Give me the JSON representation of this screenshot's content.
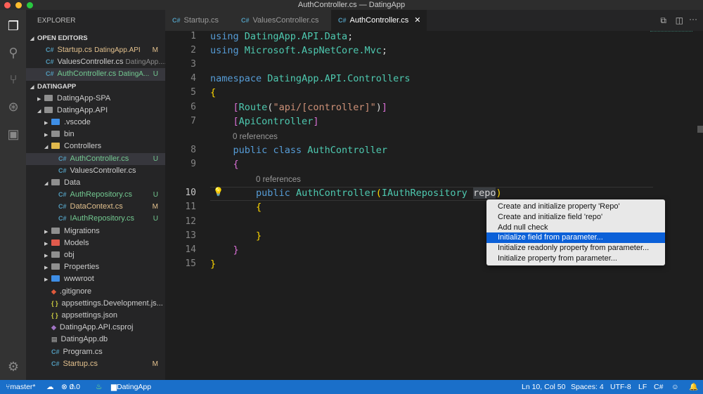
{
  "window": {
    "title": "AuthController.cs — DatingApp"
  },
  "sidebar": {
    "title": "EXPLORER",
    "open_editors_label": "OPEN EDITORS",
    "open_editors": [
      {
        "name": "Startup.cs",
        "folder": "DatingApp.API",
        "badge": "M"
      },
      {
        "name": "ValuesController.cs",
        "folder": "DatingApp....",
        "badge": ""
      },
      {
        "name": "AuthController.cs",
        "folder": "DatingA...",
        "badge": "U"
      }
    ],
    "project_label": "DATINGAPP",
    "tree": [
      {
        "name": "DatingApp-SPA",
        "type": "folder",
        "depth": 0,
        "open": false,
        "badge": ""
      },
      {
        "name": "DatingApp.API",
        "type": "folder",
        "depth": 0,
        "open": true,
        "badge": ""
      },
      {
        "name": ".vscode",
        "type": "folder",
        "depth": 1,
        "open": false,
        "badge": ""
      },
      {
        "name": "bin",
        "type": "folder",
        "depth": 1,
        "open": false,
        "badge": ""
      },
      {
        "name": "Controllers",
        "type": "folder",
        "depth": 1,
        "open": true,
        "badge": ""
      },
      {
        "name": "AuthController.cs",
        "type": "cs",
        "depth": 2,
        "badge": "U"
      },
      {
        "name": "ValuesController.cs",
        "type": "cs",
        "depth": 2,
        "badge": ""
      },
      {
        "name": "Data",
        "type": "folder",
        "depth": 1,
        "open": true,
        "badge": ""
      },
      {
        "name": "AuthRepository.cs",
        "type": "cs",
        "depth": 2,
        "badge": "U"
      },
      {
        "name": "DataContext.cs",
        "type": "cs",
        "depth": 2,
        "badge": "M"
      },
      {
        "name": "IAuthRepository.cs",
        "type": "cs",
        "depth": 2,
        "badge": "U"
      },
      {
        "name": "Migrations",
        "type": "folder",
        "depth": 1,
        "open": false,
        "badge": ""
      },
      {
        "name": "Models",
        "type": "folder",
        "depth": 1,
        "open": false,
        "badge": ""
      },
      {
        "name": "obj",
        "type": "folder",
        "depth": 1,
        "open": false,
        "badge": ""
      },
      {
        "name": "Properties",
        "type": "folder",
        "depth": 1,
        "open": false,
        "badge": ""
      },
      {
        "name": "wwwroot",
        "type": "folder",
        "depth": 1,
        "open": false,
        "badge": ""
      },
      {
        "name": ".gitignore",
        "type": "file",
        "depth": 1,
        "badge": ""
      },
      {
        "name": "appsettings.Development.js...",
        "type": "json",
        "depth": 1,
        "badge": ""
      },
      {
        "name": "appsettings.json",
        "type": "json",
        "depth": 1,
        "badge": ""
      },
      {
        "name": "DatingApp.API.csproj",
        "type": "proj",
        "depth": 1,
        "badge": ""
      },
      {
        "name": "DatingApp.db",
        "type": "file",
        "depth": 1,
        "badge": ""
      },
      {
        "name": "Program.cs",
        "type": "cs",
        "depth": 1,
        "badge": ""
      },
      {
        "name": "Startup.cs",
        "type": "cs",
        "depth": 1,
        "badge": "M"
      }
    ]
  },
  "tabs": [
    {
      "label": "Startup.cs",
      "active": false
    },
    {
      "label": "ValuesController.cs",
      "active": false
    },
    {
      "label": "AuthController.cs",
      "active": true
    }
  ],
  "editor": {
    "lines": [
      "1",
      "2",
      "3",
      "4",
      "5",
      "6",
      "7",
      "8",
      "9",
      "10",
      "11",
      "12",
      "13",
      "14",
      "15"
    ],
    "code": {
      "l1": [
        "using",
        "DatingApp.API.Data",
        ";"
      ],
      "l2": [
        "using",
        "Microsoft.AspNetCore.Mvc",
        ";"
      ],
      "l4": [
        "namespace",
        "DatingApp.API.Controllers"
      ],
      "l6": [
        "[",
        "Route",
        "(",
        "\"api/[controller]\"",
        ")",
        "]"
      ],
      "l7": [
        "[",
        "ApiController",
        "]"
      ],
      "l8": [
        "public",
        "class",
        "AuthController"
      ],
      "l10": [
        "public",
        "AuthController",
        "(",
        "IAuthRepository",
        "repo",
        ")"
      ],
      "open": "{",
      "close": "}"
    },
    "codelens": "0 references"
  },
  "quick_fix_menu": {
    "items": [
      "Create and initialize property 'Repo'",
      "Create and initialize field 'repo'",
      "Add null check",
      "Initialize field from parameter...",
      "Initialize readonly property from parameter...",
      "Initialize property from parameter..."
    ],
    "highlighted": 3
  },
  "status": {
    "branch": "master*",
    "errors": "0",
    "warnings": "0",
    "folder": "DatingApp",
    "position": "Ln 10, Col 50",
    "spaces": "Spaces: 4",
    "encoding": "UTF-8",
    "eol": "LF",
    "language": "C#"
  }
}
